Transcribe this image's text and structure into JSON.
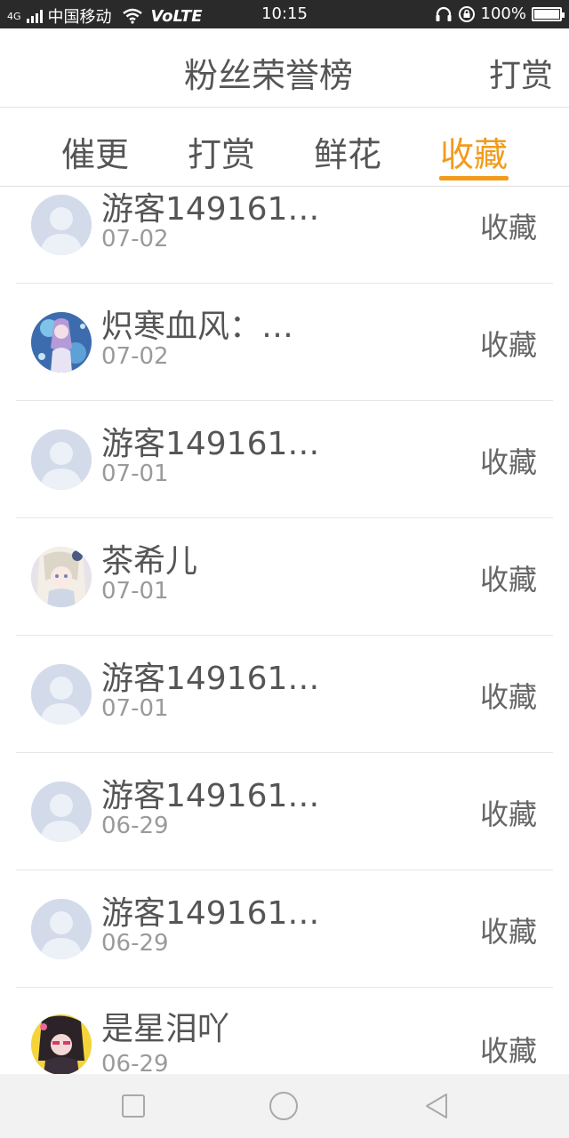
{
  "status_bar": {
    "network": "4G",
    "carrier": "中国移动",
    "volte": "VoLTE",
    "time": "10:15",
    "battery": "100%"
  },
  "header": {
    "title": "粉丝荣誉榜",
    "right_action": "打赏"
  },
  "tabs": [
    {
      "label": "催更",
      "active": false
    },
    {
      "label": "打赏",
      "active": false
    },
    {
      "label": "鲜花",
      "active": false
    },
    {
      "label": "收藏",
      "active": true
    }
  ],
  "accent_color": "#f19b1c",
  "list": [
    {
      "name": "游客149161…",
      "date": "07-02",
      "action": "收藏",
      "avatar": "default-avatar"
    },
    {
      "name": "炽寒血风：…",
      "date": "07-02",
      "action": "收藏",
      "avatar": "anime-avatar"
    },
    {
      "name": "游客149161…",
      "date": "07-01",
      "action": "收藏",
      "avatar": "default-avatar"
    },
    {
      "name": "茶希儿",
      "date": "07-01",
      "action": "收藏",
      "avatar": "anime-avatar"
    },
    {
      "name": "游客149161…",
      "date": "07-01",
      "action": "收藏",
      "avatar": "default-avatar"
    },
    {
      "name": "游客149161…",
      "date": "06-29",
      "action": "收藏",
      "avatar": "default-avatar"
    },
    {
      "name": "游客149161…",
      "date": "06-29",
      "action": "收藏",
      "avatar": "default-avatar"
    },
    {
      "name": "是星泪吖",
      "date": "06-29",
      "action": "收藏",
      "avatar": "anime-avatar"
    }
  ],
  "nav_bar": {
    "buttons": [
      "square-icon",
      "circle-icon",
      "triangle-back-icon"
    ]
  }
}
